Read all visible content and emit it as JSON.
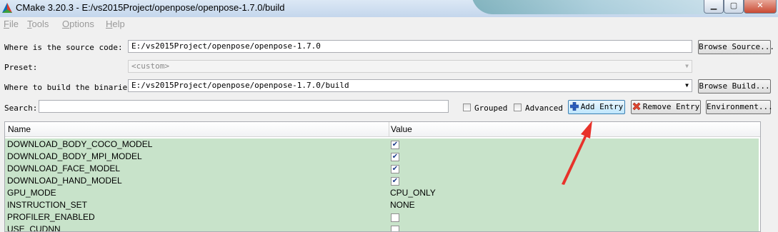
{
  "window": {
    "title": "CMake 3.20.3 - E:/vs2015Project/openpose/openpose-1.7.0/build",
    "buttons": {
      "minimize": "▁",
      "maximize": "▢",
      "close": "✕"
    }
  },
  "menu": [
    {
      "key": "F",
      "rest": "ile"
    },
    {
      "key": "T",
      "rest": "ools"
    },
    {
      "key": "O",
      "rest": "ptions"
    },
    {
      "key": "H",
      "rest": "elp"
    }
  ],
  "source": {
    "label": "Where is the source code:",
    "value": "E:/vs2015Project/openpose/openpose-1.7.0",
    "browse_label": "Browse Source..."
  },
  "preset": {
    "label": "Preset:",
    "value": "<custom>"
  },
  "build": {
    "label": "Where to build the binaries:",
    "value": "E:/vs2015Project/openpose/openpose-1.7.0/build",
    "browse_label": "Browse Build..."
  },
  "search": {
    "label": "Search:",
    "value": ""
  },
  "options": {
    "grouped_label": "Grouped",
    "advanced_label": "Advanced",
    "grouped_checked": false,
    "advanced_checked": false
  },
  "actions": {
    "add_entry": "Add Entry",
    "remove_entry": "Remove Entry",
    "environment": "Environment..."
  },
  "table": {
    "columns": [
      "Name",
      "Value"
    ],
    "rows": [
      {
        "name": "DOWNLOAD_BODY_COCO_MODEL",
        "type": "bool",
        "checked": true,
        "highlight": true
      },
      {
        "name": "DOWNLOAD_BODY_MPI_MODEL",
        "type": "bool",
        "checked": true,
        "highlight": true
      },
      {
        "name": "DOWNLOAD_FACE_MODEL",
        "type": "bool",
        "checked": true,
        "highlight": true
      },
      {
        "name": "DOWNLOAD_HAND_MODEL",
        "type": "bool",
        "checked": true,
        "highlight": true
      },
      {
        "name": "GPU_MODE",
        "type": "text",
        "value": "CPU_ONLY",
        "highlight": true
      },
      {
        "name": "INSTRUCTION_SET",
        "type": "text",
        "value": "NONE",
        "highlight": true
      },
      {
        "name": "PROFILER_ENABLED",
        "type": "bool",
        "checked": false,
        "highlight": true
      },
      {
        "name": "USE_CUDNN",
        "type": "bool",
        "checked": false,
        "highlight": true
      }
    ]
  },
  "colors": {
    "row_highlight": "#c8e3ca",
    "annotation_arrow": "#e8322a"
  },
  "icons": {
    "add_entry": "plus-icon",
    "remove_entry": "x-icon",
    "app": "cmake-triangle-icon"
  }
}
